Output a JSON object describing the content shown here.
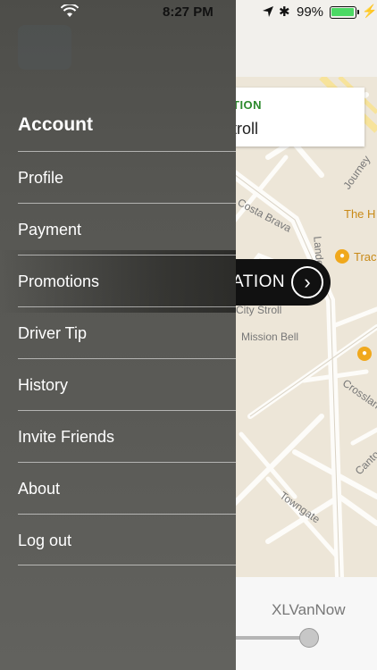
{
  "status_bar": {
    "time": "8:27 PM",
    "battery_percent": "99%",
    "battery_level": 0.99,
    "wifi_icon": "wifi-icon",
    "location_icon": "location-arrow-icon",
    "bluetooth_icon": "bluetooth-icon",
    "charging_icon": "charging-bolt-icon"
  },
  "side_menu": {
    "heading": "Account",
    "items": [
      {
        "label": "Profile"
      },
      {
        "label": "Payment"
      },
      {
        "label": "Promotions"
      },
      {
        "label": "Driver Tip"
      },
      {
        "label": "History"
      },
      {
        "label": "Invite Friends"
      },
      {
        "label": "About"
      },
      {
        "label": "Log out"
      }
    ]
  },
  "destination_card": {
    "caption": "TION",
    "value": "troll"
  },
  "confirm_button": {
    "label": "ATION",
    "icon": "chevron-right-icon"
  },
  "map": {
    "street_labels": [
      "Costa Brava",
      "Journey",
      "Lande",
      "City Stroll",
      "Mission Bell",
      "Crosslane",
      "Canto",
      "Towngate"
    ],
    "poi_labels": [
      "The H",
      "Trac"
    ]
  },
  "vehicle_selector": {
    "label": "XLVanNow",
    "slider_level": 1.0
  },
  "colors": {
    "drawer_bg": "#5a5a56",
    "destination_caption": "#2d8a2d",
    "poi": "#f0a81c",
    "battery_fill": "#4cd964",
    "confirm_bg": "#111111"
  }
}
